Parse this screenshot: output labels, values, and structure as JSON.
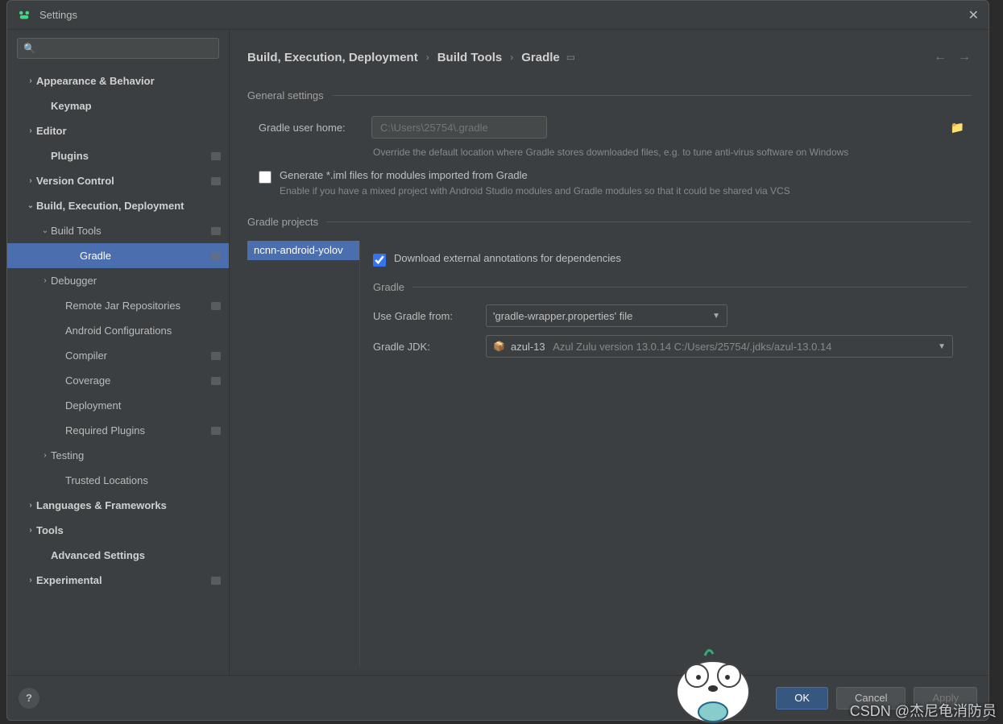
{
  "title": "Settings",
  "search": {
    "placeholder": ""
  },
  "sidebar": {
    "items": [
      {
        "label": "Appearance & Behavior",
        "bold": true,
        "arrow": ">",
        "pad": 0,
        "badge": false
      },
      {
        "label": "Keymap",
        "bold": true,
        "arrow": "",
        "pad": 1,
        "badge": false
      },
      {
        "label": "Editor",
        "bold": true,
        "arrow": ">",
        "pad": 0,
        "badge": false
      },
      {
        "label": "Plugins",
        "bold": true,
        "arrow": "",
        "pad": 1,
        "badge": true
      },
      {
        "label": "Version Control",
        "bold": true,
        "arrow": ">",
        "pad": 0,
        "badge": true
      },
      {
        "label": "Build, Execution, Deployment",
        "bold": true,
        "arrow": "v",
        "pad": 0,
        "badge": false
      },
      {
        "label": "Build Tools",
        "bold": false,
        "arrow": "v",
        "pad": 1,
        "badge": true
      },
      {
        "label": "Gradle",
        "bold": false,
        "arrow": "",
        "pad": 3,
        "badge": true,
        "selected": true
      },
      {
        "label": "Debugger",
        "bold": false,
        "arrow": ">",
        "pad": 1,
        "badge": false
      },
      {
        "label": "Remote Jar Repositories",
        "bold": false,
        "arrow": "",
        "pad": 2,
        "badge": true
      },
      {
        "label": "Android Configurations",
        "bold": false,
        "arrow": "",
        "pad": 2,
        "badge": false
      },
      {
        "label": "Compiler",
        "bold": false,
        "arrow": "",
        "pad": 2,
        "badge": true
      },
      {
        "label": "Coverage",
        "bold": false,
        "arrow": "",
        "pad": 2,
        "badge": true
      },
      {
        "label": "Deployment",
        "bold": false,
        "arrow": "",
        "pad": 2,
        "badge": false
      },
      {
        "label": "Required Plugins",
        "bold": false,
        "arrow": "",
        "pad": 2,
        "badge": true
      },
      {
        "label": "Testing",
        "bold": false,
        "arrow": ">",
        "pad": 1,
        "badge": false
      },
      {
        "label": "Trusted Locations",
        "bold": false,
        "arrow": "",
        "pad": 2,
        "badge": false
      },
      {
        "label": "Languages & Frameworks",
        "bold": true,
        "arrow": ">",
        "pad": 0,
        "badge": false
      },
      {
        "label": "Tools",
        "bold": true,
        "arrow": ">",
        "pad": 0,
        "badge": false
      },
      {
        "label": "Advanced Settings",
        "bold": true,
        "arrow": "",
        "pad": 1,
        "badge": false
      },
      {
        "label": "Experimental",
        "bold": true,
        "arrow": ">",
        "pad": 0,
        "badge": true
      }
    ]
  },
  "breadcrumb": [
    "Build, Execution, Deployment",
    "Build Tools",
    "Gradle"
  ],
  "general": {
    "title": "General settings",
    "user_home_label": "Gradle user home:",
    "user_home_value": "C:\\Users\\25754\\.gradle",
    "user_home_hint": "Override the default location where Gradle stores downloaded files, e.g. to tune anti-virus software on Windows",
    "iml_label": "Generate *.iml files for modules imported from Gradle",
    "iml_hint": "Enable if you have a mixed project with Android Studio modules and Gradle modules so that it could be shared via VCS"
  },
  "projects": {
    "title": "Gradle projects",
    "list": [
      "ncnn-android-yolov"
    ],
    "download_annotations": "Download external annotations for dependencies",
    "gradle_section": "Gradle",
    "use_from_label": "Use Gradle from:",
    "use_from_value": "'gradle-wrapper.properties' file",
    "jdk_label": "Gradle JDK:",
    "jdk_name": "azul-13",
    "jdk_detail": "Azul Zulu version 13.0.14 C:/Users/25754/.jdks/azul-13.0.14"
  },
  "footer": {
    "ok": "OK",
    "cancel": "Cancel",
    "apply": "Apply"
  },
  "watermark": "CSDN @杰尼龟消防员"
}
